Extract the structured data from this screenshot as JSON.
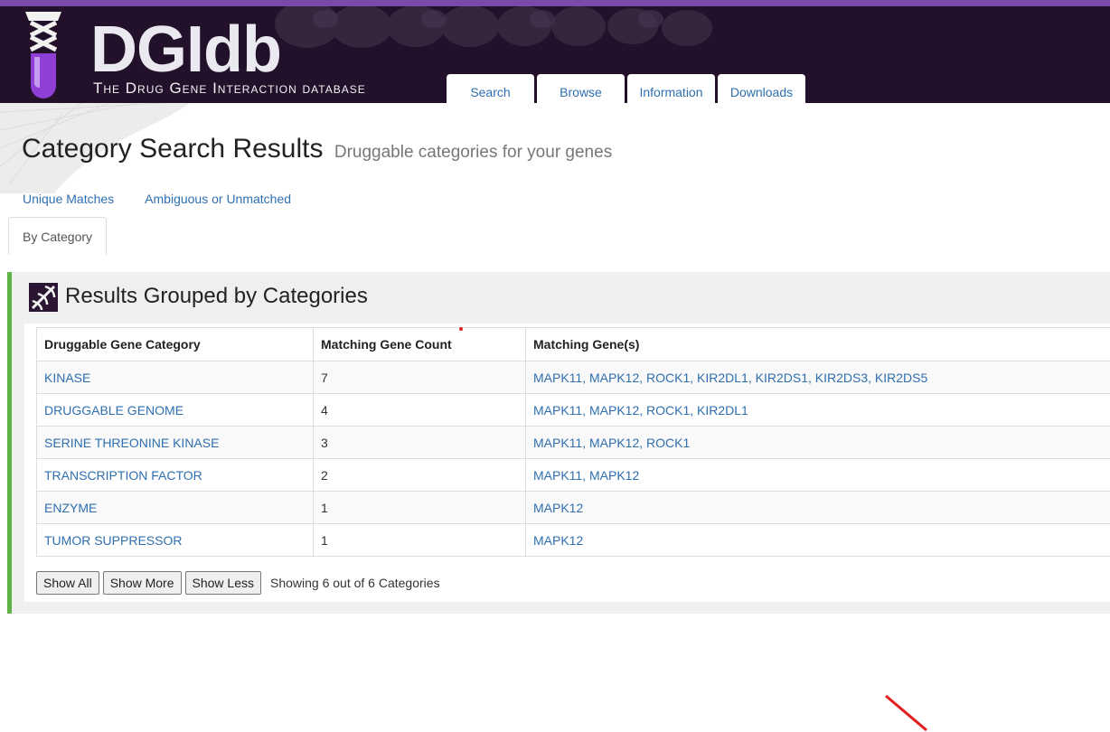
{
  "logo": {
    "title": "DGIdb",
    "subtitle": "The Drug Gene Interaction database"
  },
  "nav": {
    "tabs": [
      "Search",
      "Browse",
      "Information",
      "Downloads"
    ]
  },
  "page": {
    "title": "Category Search Results",
    "subtitle": "Druggable categories for your genes"
  },
  "result_tabs": {
    "unique": "Unique Matches",
    "ambiguous": "Ambiguous or Unmatched",
    "active": "By Category"
  },
  "panel": {
    "title": "Results Grouped by Categories",
    "icon": "dna-icon"
  },
  "table": {
    "headers": [
      "Druggable Gene Category",
      "Matching Gene Count",
      "Matching Gene(s)"
    ],
    "rows": [
      {
        "category": "KINASE",
        "count": "7",
        "genes": "MAPK11, MAPK12, ROCK1, KIR2DL1, KIR2DS1, KIR2DS3, KIR2DS5"
      },
      {
        "category": "DRUGGABLE GENOME",
        "count": "4",
        "genes": "MAPK11, MAPK12, ROCK1, KIR2DL1"
      },
      {
        "category": "SERINE THREONINE KINASE",
        "count": "3",
        "genes": "MAPK11, MAPK12, ROCK1"
      },
      {
        "category": "TRANSCRIPTION FACTOR",
        "count": "2",
        "genes": "MAPK11, MAPK12"
      },
      {
        "category": "ENZYME",
        "count": "1",
        "genes": "MAPK12"
      },
      {
        "category": "TUMOR SUPPRESSOR",
        "count": "1",
        "genes": "MAPK12"
      }
    ]
  },
  "buttons": {
    "show_all": "Show All",
    "show_more": "Show More",
    "show_less": "Show Less",
    "showing": "Showing 6 out of 6 Categories"
  },
  "colors": {
    "header_bg": "#23112c",
    "header_stripe": "#7b4aa9",
    "link": "#2f6fb0",
    "panel_accent": "#5fb347"
  }
}
